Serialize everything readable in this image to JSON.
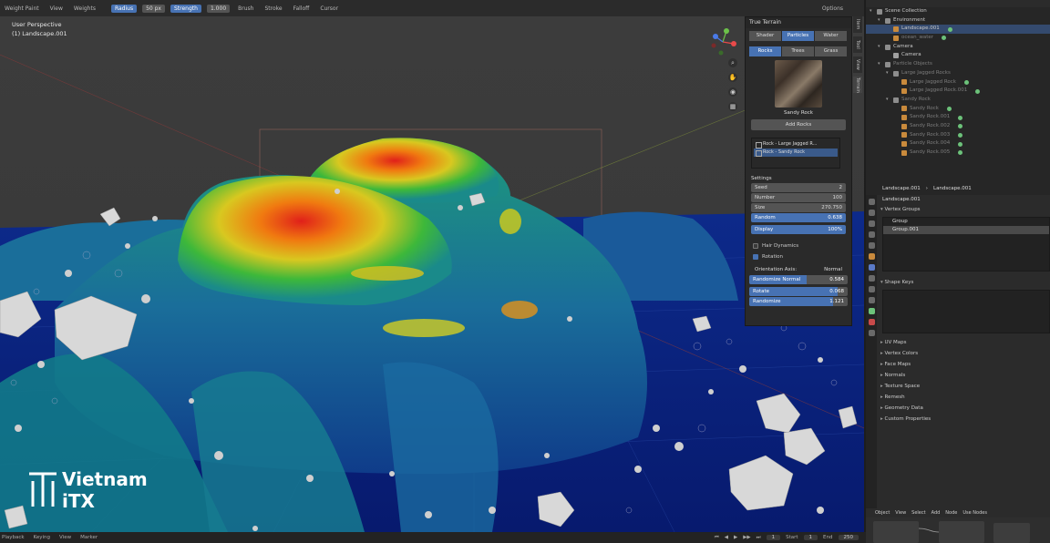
{
  "header": {
    "mode": "Weight Paint",
    "menus": [
      "View",
      "Weights"
    ],
    "radius_label": "Radius",
    "radius_value": "50 px",
    "strength_label": "Strength",
    "strength_value": "1.000",
    "tools": [
      "Brush",
      "Stroke",
      "Falloff",
      "Cursor"
    ],
    "options": "Options"
  },
  "viewport": {
    "view_name": "User Perspective",
    "object_name": "(1) Landscape.001"
  },
  "npanel": {
    "title": "True Terrain",
    "main_tabs": [
      {
        "label": "Shader",
        "active": false
      },
      {
        "label": "Particles",
        "active": true
      },
      {
        "label": "Water",
        "active": false
      }
    ],
    "sub_tabs": [
      {
        "label": "Rocks",
        "active": true
      },
      {
        "label": "Trees",
        "active": false
      },
      {
        "label": "Grass",
        "active": false
      }
    ],
    "thumbnail_label": "Sandy Rock",
    "add_button": "Add Rocks",
    "particle_list": [
      {
        "label": "Rock - Large Jagged R...",
        "selected": false
      },
      {
        "label": "Rock - Sandy Rock",
        "selected": true
      }
    ],
    "settings_label": "Settings",
    "fields": [
      {
        "label": "Seed",
        "value": "2"
      },
      {
        "label": "Number",
        "value": "100"
      },
      {
        "label": "Size",
        "value": "270.750"
      },
      {
        "label": "Random",
        "value": "0.638"
      }
    ],
    "display": {
      "label": "Display",
      "value": "100%"
    },
    "hair_dynamics": {
      "label": "Hair Dynamics",
      "checked": false
    },
    "rotation": {
      "label": "Rotation",
      "checked": true
    },
    "orientation_axis": {
      "label": "Orientation Axis:",
      "value": "Normal"
    },
    "sliders": [
      {
        "label": "Randomize Normal",
        "value": "0.584",
        "fraction": 0.58
      },
      {
        "label": "Rotate",
        "value": "0.068",
        "fraction": 0.9
      },
      {
        "label": "Randomize",
        "value": "1.121",
        "fraction": 0.85
      }
    ],
    "side_tabs": [
      "Item",
      "Tool",
      "View",
      "Terrain"
    ]
  },
  "outliner": {
    "rows": [
      {
        "label": "Scene Collection",
        "indent": 0,
        "icon": "coll",
        "selected": false,
        "dim": false
      },
      {
        "label": "Environment",
        "indent": 1,
        "icon": "coll",
        "selected": false,
        "dim": false
      },
      {
        "label": "Landscape.001",
        "indent": 2,
        "icon": "mesh",
        "selected": true,
        "dim": false
      },
      {
        "label": "ocean_water",
        "indent": 2,
        "icon": "mesh",
        "selected": false,
        "dim": true
      },
      {
        "label": "Camera",
        "indent": 1,
        "icon": "coll",
        "selected": false,
        "dim": false
      },
      {
        "label": "Camera",
        "indent": 2,
        "icon": "cam",
        "selected": false,
        "dim": false
      },
      {
        "label": "Particle Objects",
        "indent": 1,
        "icon": "coll",
        "selected": false,
        "dim": true
      },
      {
        "label": "Large Jagged Rocks",
        "indent": 2,
        "icon": "coll",
        "selected": false,
        "dim": true
      },
      {
        "label": "Large Jagged Rock",
        "indent": 3,
        "icon": "mesh",
        "selected": false,
        "dim": true
      },
      {
        "label": "Large Jagged Rock.001",
        "indent": 3,
        "icon": "mesh",
        "selected": false,
        "dim": true
      },
      {
        "label": "Sandy Rock",
        "indent": 2,
        "icon": "coll",
        "selected": false,
        "dim": true
      },
      {
        "label": "Sandy Rock",
        "indent": 3,
        "icon": "mesh",
        "selected": false,
        "dim": true
      },
      {
        "label": "Sandy Rock.001",
        "indent": 3,
        "icon": "mesh",
        "selected": false,
        "dim": true
      },
      {
        "label": "Sandy Rock.002",
        "indent": 3,
        "icon": "mesh",
        "selected": false,
        "dim": true
      },
      {
        "label": "Sandy Rock.003",
        "indent": 3,
        "icon": "mesh",
        "selected": false,
        "dim": true
      },
      {
        "label": "Sandy Rock.004",
        "indent": 3,
        "icon": "mesh",
        "selected": false,
        "dim": true
      },
      {
        "label": "Sandy Rock.005",
        "indent": 3,
        "icon": "mesh",
        "selected": false,
        "dim": true
      }
    ]
  },
  "properties": {
    "breadcrumb_object": "Landscape.001",
    "breadcrumb_data": "Landscape.001",
    "data_name": "Landscape.001",
    "vertex_groups_label": "Vertex Groups",
    "vertex_groups": [
      {
        "label": "Group",
        "selected": false
      },
      {
        "label": "Group.001",
        "selected": true
      }
    ],
    "shape_keys_label": "Shape Keys",
    "collapsed_panels": [
      "UV Maps",
      "Vertex Colors",
      "Face Maps",
      "Normals",
      "Texture Space",
      "Remesh",
      "Geometry Data",
      "Custom Properties"
    ]
  },
  "node_editor": {
    "menus": [
      "Object",
      "View",
      "Select",
      "Add",
      "Node"
    ],
    "use_nodes": "Use Nodes"
  },
  "timeline": {
    "menus": [
      "Playback",
      "Keying",
      "View",
      "Marker"
    ],
    "current_frame": "1",
    "start_label": "Start",
    "start_value": "1",
    "end_label": "End",
    "end_value": "250"
  },
  "watermark": {
    "line1": "Vietnam",
    "line2": "iTX"
  },
  "colors": {
    "accent": "#4772b3",
    "selected_row": "#344a6e"
  }
}
